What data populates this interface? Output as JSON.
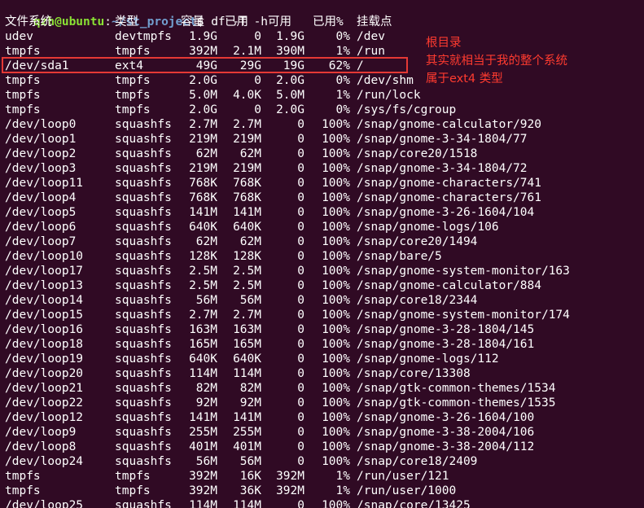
{
  "prompt": {
    "user_host": "qzh@ubuntu",
    "separator": ":",
    "path": "~/st_project",
    "symbol": "$",
    "command": " df -T -h"
  },
  "headers": {
    "filesystem": "文件系统",
    "type": "类型",
    "size": "容量",
    "used": "已用",
    "avail": "可用",
    "use_pct": "已用%",
    "mounted_on": "挂载点"
  },
  "rows": [
    {
      "fs": "udev",
      "type": "devtmpfs",
      "size": "1.9G",
      "used": "0",
      "avail": "1.9G",
      "pct": "0%",
      "mount": "/dev"
    },
    {
      "fs": "tmpfs",
      "type": "tmpfs",
      "size": "392M",
      "used": "2.1M",
      "avail": "390M",
      "pct": "1%",
      "mount": "/run"
    },
    {
      "fs": "/dev/sda1",
      "type": "ext4",
      "size": "49G",
      "used": "29G",
      "avail": "19G",
      "pct": "62%",
      "mount": "/"
    },
    {
      "fs": "tmpfs",
      "type": "tmpfs",
      "size": "2.0G",
      "used": "0",
      "avail": "2.0G",
      "pct": "0%",
      "mount": "/dev/shm"
    },
    {
      "fs": "tmpfs",
      "type": "tmpfs",
      "size": "5.0M",
      "used": "4.0K",
      "avail": "5.0M",
      "pct": "1%",
      "mount": "/run/lock"
    },
    {
      "fs": "tmpfs",
      "type": "tmpfs",
      "size": "2.0G",
      "used": "0",
      "avail": "2.0G",
      "pct": "0%",
      "mount": "/sys/fs/cgroup"
    },
    {
      "fs": "/dev/loop0",
      "type": "squashfs",
      "size": "2.7M",
      "used": "2.7M",
      "avail": "0",
      "pct": "100%",
      "mount": "/snap/gnome-calculator/920"
    },
    {
      "fs": "/dev/loop1",
      "type": "squashfs",
      "size": "219M",
      "used": "219M",
      "avail": "0",
      "pct": "100%",
      "mount": "/snap/gnome-3-34-1804/77"
    },
    {
      "fs": "/dev/loop2",
      "type": "squashfs",
      "size": "62M",
      "used": "62M",
      "avail": "0",
      "pct": "100%",
      "mount": "/snap/core20/1518"
    },
    {
      "fs": "/dev/loop3",
      "type": "squashfs",
      "size": "219M",
      "used": "219M",
      "avail": "0",
      "pct": "100%",
      "mount": "/snap/gnome-3-34-1804/72"
    },
    {
      "fs": "/dev/loop11",
      "type": "squashfs",
      "size": "768K",
      "used": "768K",
      "avail": "0",
      "pct": "100%",
      "mount": "/snap/gnome-characters/741"
    },
    {
      "fs": "/dev/loop4",
      "type": "squashfs",
      "size": "768K",
      "used": "768K",
      "avail": "0",
      "pct": "100%",
      "mount": "/snap/gnome-characters/761"
    },
    {
      "fs": "/dev/loop5",
      "type": "squashfs",
      "size": "141M",
      "used": "141M",
      "avail": "0",
      "pct": "100%",
      "mount": "/snap/gnome-3-26-1604/104"
    },
    {
      "fs": "/dev/loop6",
      "type": "squashfs",
      "size": "640K",
      "used": "640K",
      "avail": "0",
      "pct": "100%",
      "mount": "/snap/gnome-logs/106"
    },
    {
      "fs": "/dev/loop7",
      "type": "squashfs",
      "size": "62M",
      "used": "62M",
      "avail": "0",
      "pct": "100%",
      "mount": "/snap/core20/1494"
    },
    {
      "fs": "/dev/loop10",
      "type": "squashfs",
      "size": "128K",
      "used": "128K",
      "avail": "0",
      "pct": "100%",
      "mount": "/snap/bare/5"
    },
    {
      "fs": "/dev/loop17",
      "type": "squashfs",
      "size": "2.5M",
      "used": "2.5M",
      "avail": "0",
      "pct": "100%",
      "mount": "/snap/gnome-system-monitor/163"
    },
    {
      "fs": "/dev/loop13",
      "type": "squashfs",
      "size": "2.5M",
      "used": "2.5M",
      "avail": "0",
      "pct": "100%",
      "mount": "/snap/gnome-calculator/884"
    },
    {
      "fs": "/dev/loop14",
      "type": "squashfs",
      "size": "56M",
      "used": "56M",
      "avail": "0",
      "pct": "100%",
      "mount": "/snap/core18/2344"
    },
    {
      "fs": "/dev/loop15",
      "type": "squashfs",
      "size": "2.7M",
      "used": "2.7M",
      "avail": "0",
      "pct": "100%",
      "mount": "/snap/gnome-system-monitor/174"
    },
    {
      "fs": "/dev/loop16",
      "type": "squashfs",
      "size": "163M",
      "used": "163M",
      "avail": "0",
      "pct": "100%",
      "mount": "/snap/gnome-3-28-1804/145"
    },
    {
      "fs": "/dev/loop18",
      "type": "squashfs",
      "size": "165M",
      "used": "165M",
      "avail": "0",
      "pct": "100%",
      "mount": "/snap/gnome-3-28-1804/161"
    },
    {
      "fs": "/dev/loop19",
      "type": "squashfs",
      "size": "640K",
      "used": "640K",
      "avail": "0",
      "pct": "100%",
      "mount": "/snap/gnome-logs/112"
    },
    {
      "fs": "/dev/loop20",
      "type": "squashfs",
      "size": "114M",
      "used": "114M",
      "avail": "0",
      "pct": "100%",
      "mount": "/snap/core/13308"
    },
    {
      "fs": "/dev/loop21",
      "type": "squashfs",
      "size": "82M",
      "used": "82M",
      "avail": "0",
      "pct": "100%",
      "mount": "/snap/gtk-common-themes/1534"
    },
    {
      "fs": "/dev/loop22",
      "type": "squashfs",
      "size": "92M",
      "used": "92M",
      "avail": "0",
      "pct": "100%",
      "mount": "/snap/gtk-common-themes/1535"
    },
    {
      "fs": "/dev/loop12",
      "type": "squashfs",
      "size": "141M",
      "used": "141M",
      "avail": "0",
      "pct": "100%",
      "mount": "/snap/gnome-3-26-1604/100"
    },
    {
      "fs": "/dev/loop9",
      "type": "squashfs",
      "size": "255M",
      "used": "255M",
      "avail": "0",
      "pct": "100%",
      "mount": "/snap/gnome-3-38-2004/106"
    },
    {
      "fs": "/dev/loop8",
      "type": "squashfs",
      "size": "401M",
      "used": "401M",
      "avail": "0",
      "pct": "100%",
      "mount": "/snap/gnome-3-38-2004/112"
    },
    {
      "fs": "/dev/loop24",
      "type": "squashfs",
      "size": "56M",
      "used": "56M",
      "avail": "0",
      "pct": "100%",
      "mount": "/snap/core18/2409"
    },
    {
      "fs": "tmpfs",
      "type": "tmpfs",
      "size": "392M",
      "used": "16K",
      "avail": "392M",
      "pct": "1%",
      "mount": "/run/user/121"
    },
    {
      "fs": "tmpfs",
      "type": "tmpfs",
      "size": "392M",
      "used": "36K",
      "avail": "392M",
      "pct": "1%",
      "mount": "/run/user/1000"
    },
    {
      "fs": "/dev/loop25",
      "type": "squashfs",
      "size": "114M",
      "used": "114M",
      "avail": "0",
      "pct": "100%",
      "mount": "/snap/core/13425"
    }
  ],
  "annotation": {
    "lines": [
      "根目录",
      "其实就相当于我的整个系统",
      "属于ext4 类型"
    ]
  },
  "colors": {
    "background": "#300a24",
    "text": "#ffffff",
    "prompt_user": "#8ae234",
    "prompt_path": "#729fcf",
    "annotation": "#ff3b2f"
  }
}
